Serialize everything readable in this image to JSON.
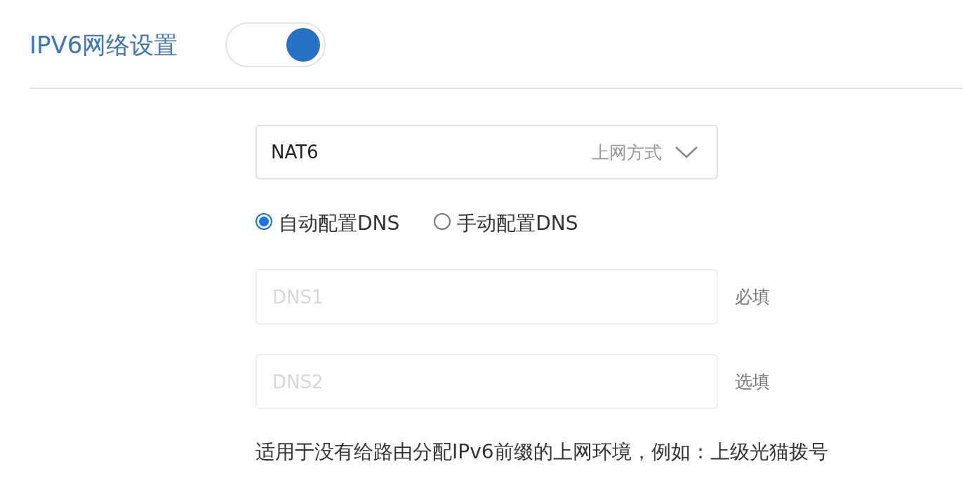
{
  "header": {
    "title": "IPV6网络设置",
    "toggle": {
      "on": true
    }
  },
  "connection_select": {
    "value": "NAT6",
    "label": "上网方式"
  },
  "dns_mode": [
    {
      "label": "自动配置DNS",
      "selected": true
    },
    {
      "label": "手动配置DNS",
      "selected": false
    }
  ],
  "dns_fields": [
    {
      "placeholder": "DNS1",
      "hint": "必填",
      "disabled": true
    },
    {
      "placeholder": "DNS2",
      "hint": "选填",
      "disabled": true
    }
  ],
  "note": "适用于没有给路由分配IPv6前缀的上网环境，例如：上级光猫拨号"
}
